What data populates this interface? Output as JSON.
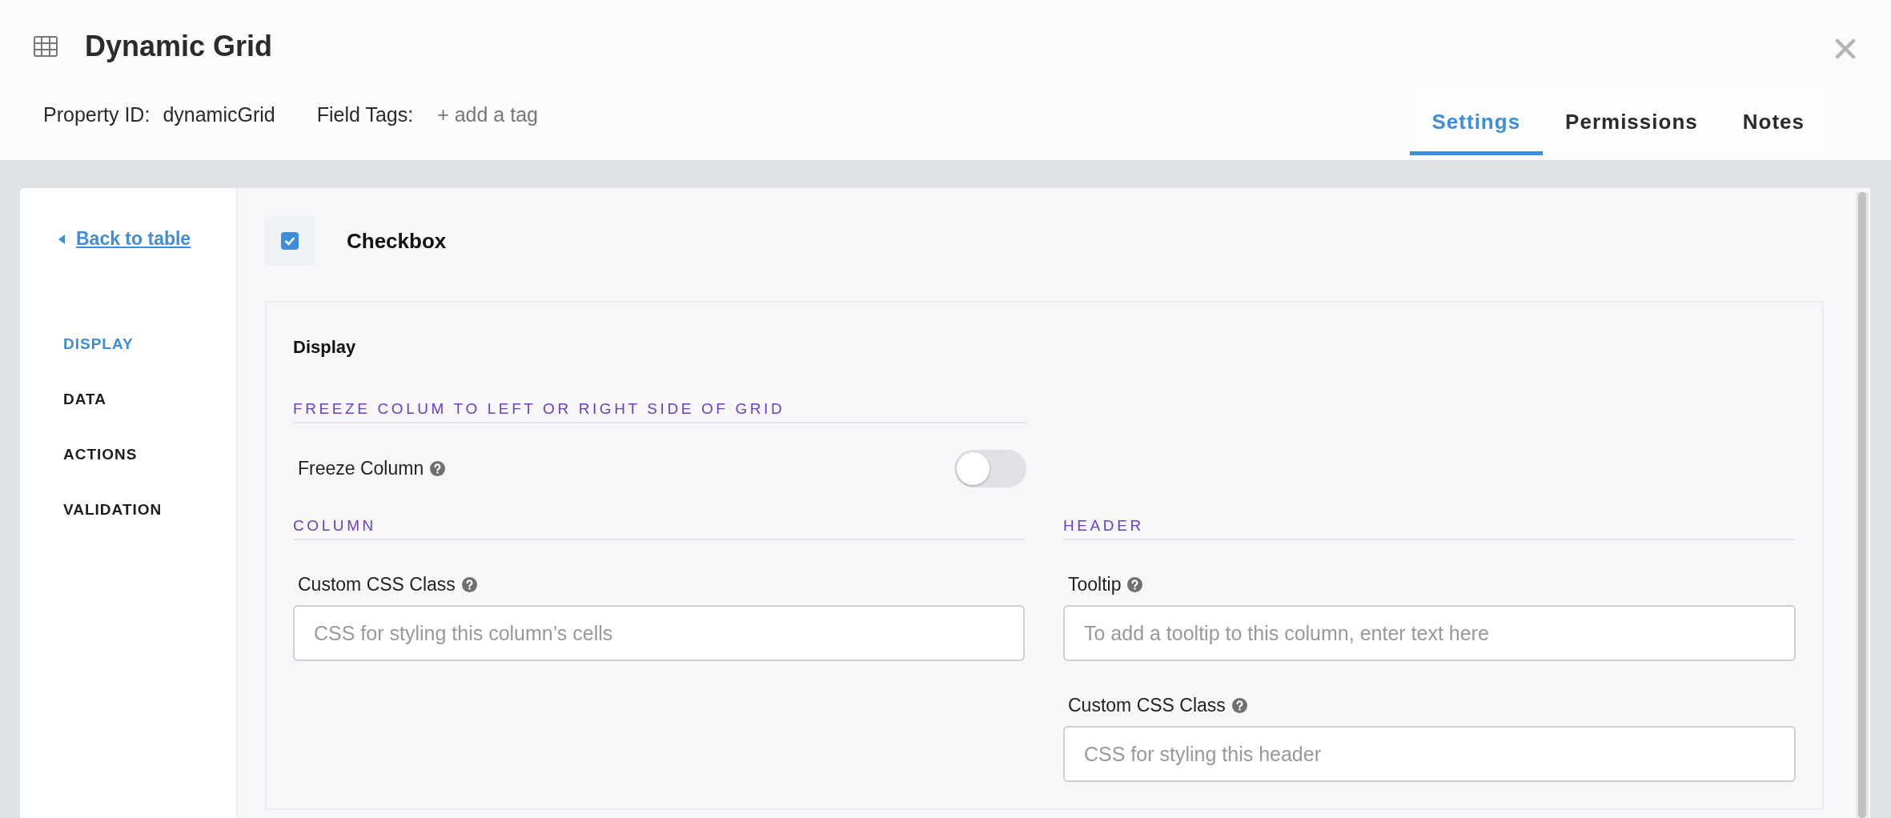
{
  "header": {
    "title": "Dynamic Grid",
    "property_id_label": "Property ID:",
    "property_id": "dynamicGrid",
    "field_tags_label": "Field Tags:",
    "add_tag": "+ add a tag"
  },
  "tabs": [
    {
      "label": "Settings",
      "selected": true
    },
    {
      "label": "Permissions",
      "selected": false
    },
    {
      "label": "Notes",
      "selected": false
    }
  ],
  "sidebar": {
    "back_link": "Back to table",
    "items": [
      {
        "label": "DISPLAY",
        "selected": true
      },
      {
        "label": "DATA",
        "selected": false
      },
      {
        "label": "ACTIONS",
        "selected": false
      },
      {
        "label": "VALIDATION",
        "selected": false
      }
    ]
  },
  "field_type": {
    "label": "Checkbox",
    "checked": true
  },
  "panel": {
    "title": "Display",
    "freeze_section": {
      "heading": "FREEZE COLUM TO LEFT OR RIGHT SIDE OF GRID",
      "toggle": {
        "label": "Freeze Column",
        "on": false
      }
    },
    "column_section": {
      "heading": "COLUMN",
      "fields": [
        {
          "label": "Custom CSS Class",
          "placeholder": "CSS for styling this column’s cells"
        }
      ]
    },
    "header_section": {
      "heading": "HEADER",
      "fields": [
        {
          "label": "Tooltip",
          "placeholder": "To add a tooltip to this column, enter text here"
        },
        {
          "label": "Custom CSS Class",
          "placeholder": "CSS for styling this header"
        }
      ]
    }
  }
}
